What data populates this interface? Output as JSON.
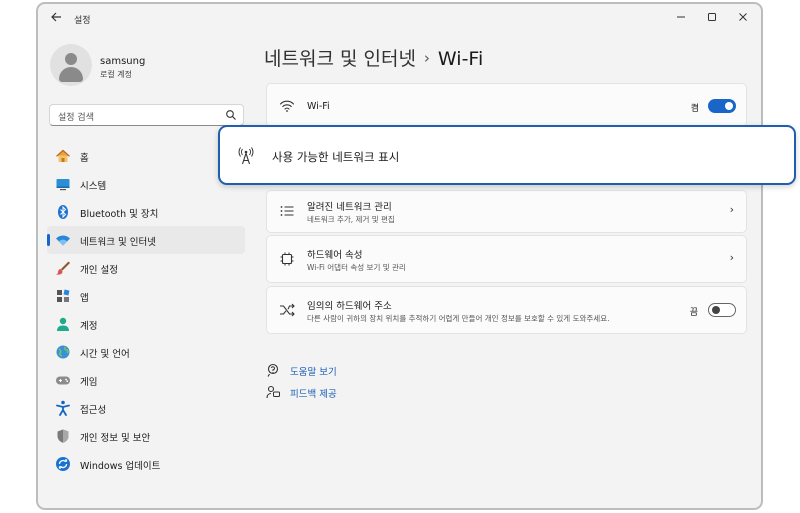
{
  "window": {
    "title": "설정"
  },
  "profile": {
    "name": "samsung",
    "account_type": "로컬 계정"
  },
  "search": {
    "placeholder": "설정 검색"
  },
  "nav": {
    "items": [
      {
        "label": "홈",
        "icon": "home-icon"
      },
      {
        "label": "시스템",
        "icon": "system-icon"
      },
      {
        "label": "Bluetooth 및 장치",
        "icon": "bluetooth-icon"
      },
      {
        "label": "네트워크 및 인터넷",
        "icon": "network-icon",
        "active": true
      },
      {
        "label": "개인 설정",
        "icon": "brush-icon"
      },
      {
        "label": "앱",
        "icon": "apps-icon"
      },
      {
        "label": "계정",
        "icon": "account-icon"
      },
      {
        "label": "시간 및 언어",
        "icon": "globe-icon"
      },
      {
        "label": "게임",
        "icon": "gamepad-icon"
      },
      {
        "label": "접근성",
        "icon": "accessibility-icon"
      },
      {
        "label": "개인 정보 및 보안",
        "icon": "shield-icon"
      },
      {
        "label": "Windows 업데이트",
        "icon": "update-icon"
      }
    ]
  },
  "breadcrumb": {
    "parent": "네트워크 및 인터넷",
    "separator": "›",
    "current": "Wi-Fi"
  },
  "wifi": {
    "label": "Wi-Fi",
    "toggle_label": "켬",
    "enabled": true
  },
  "callout": {
    "label": "사용 가능한 네트워크 표시"
  },
  "known_networks": {
    "title": "알려진 네트워크 관리",
    "subtitle": "네트워크 추가, 제거 및 편집"
  },
  "hardware": {
    "title": "하드웨어 속성",
    "subtitle": "Wi-Fi 어댑터 속성 보기 및 관리"
  },
  "random_hw": {
    "title": "임의의 하드웨어 주소",
    "subtitle": "다른 사람이 귀하의 장치 위치를 추적하기 어렵게 만들어 개인 정보를 보호할 수 있게 도와주세요.",
    "toggle_label": "끔",
    "enabled": false
  },
  "links": {
    "help": "도움말 보기",
    "feedback": "피드백 제공"
  },
  "colors": {
    "accent": "#1a66c8",
    "callout_border": "#1f5fad"
  }
}
